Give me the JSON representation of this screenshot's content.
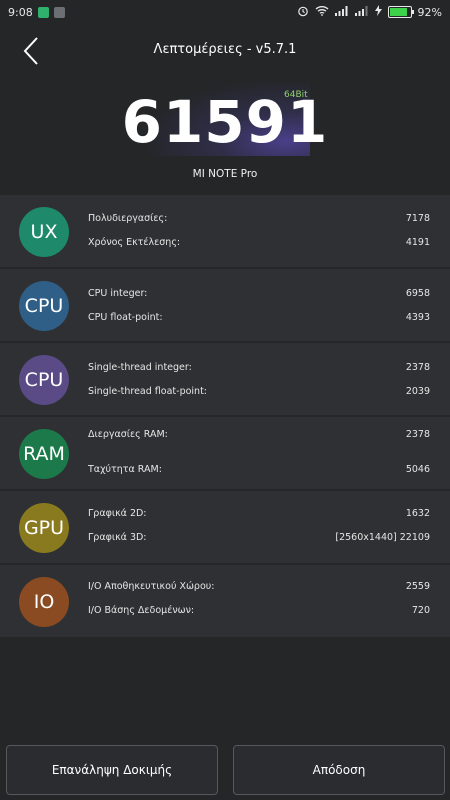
{
  "status_bar": {
    "time": "9:08",
    "battery_percent": "92%",
    "battery_level": 0.92
  },
  "header": {
    "title": "Λεπτομέρειες - v5.7.1"
  },
  "score": {
    "value": "61591",
    "bit_label": "64Bit",
    "device": "MI NOTE Pro"
  },
  "categories": [
    {
      "badge": "UX",
      "color": "#1f8a6b",
      "items": [
        {
          "label": "Πολυδιεργασίες:",
          "value": "7178"
        },
        {
          "label": "Χρόνος Εκτέλεσης:",
          "value": "4191"
        }
      ]
    },
    {
      "badge": "CPU",
      "color": "#2f5f86",
      "items": [
        {
          "label": "CPU integer:",
          "value": "6958"
        },
        {
          "label": "CPU float-point:",
          "value": "4393"
        }
      ]
    },
    {
      "badge": "CPU",
      "color": "#5a4a86",
      "items": [
        {
          "label": "Single-thread integer:",
          "value": "2378"
        },
        {
          "label": "Single-thread float-point:",
          "value": "2039"
        }
      ]
    },
    {
      "badge": "RAM",
      "color": "#1c7a4a",
      "items": [
        {
          "label": "Διεργασίες RAM:",
          "value": "2378"
        },
        {
          "label": "Ταχύτητα RAM:",
          "value": "5046"
        }
      ]
    },
    {
      "badge": "GPU",
      "color": "#8a7a1f",
      "items": [
        {
          "label": "Γραφικά 2D:",
          "value": "1632"
        },
        {
          "label": "Γραφικά 3D:",
          "value": "[2560x1440] 22109"
        }
      ]
    },
    {
      "badge": "IO",
      "color": "#8a4a22",
      "items": [
        {
          "label": "I/O Αποθηκευτικού Χώρου:",
          "value": "2559"
        },
        {
          "label": "I/O Βάσης Δεδομένων:",
          "value": "720"
        }
      ]
    }
  ],
  "buttons": {
    "retest": "Επανάληψη Δοκιμής",
    "performance": "Απόδοση"
  }
}
